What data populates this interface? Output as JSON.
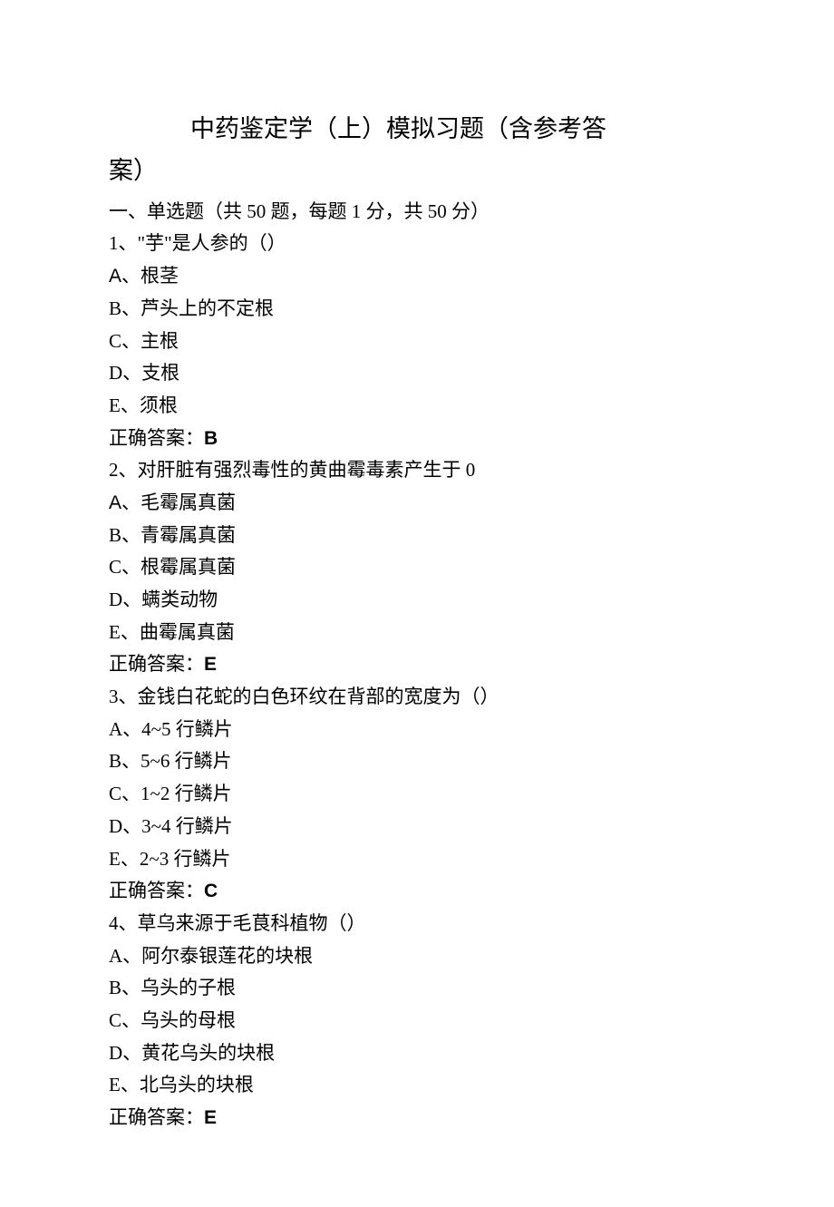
{
  "title_part1": "中药鉴定学（上）模拟习题（含参考答",
  "title_part2": "案）",
  "section_header": "一、单选题（共 50 题，每题 1 分，共 50 分）",
  "questions": [
    {
      "stem": "1、\"芋\"是人参的（）",
      "options": [
        "A、根茎",
        "B、芦头上的不定根",
        "C、主根",
        "D、支根",
        "E、须根"
      ],
      "answer_label": "正确答案：",
      "answer_value": "B",
      "opt_a_sans": true
    },
    {
      "stem": "2、对肝脏有强烈毒性的黄曲霉毒素产生于 0",
      "options": [
        "A、毛霉属真菌",
        "B、青霉属真菌",
        "C、根霉属真菌",
        "D、螨类动物",
        "E、曲霉属真菌"
      ],
      "answer_label": "正确答案：",
      "answer_value": "E",
      "opt_a_sans": true
    },
    {
      "stem": "3、金钱白花蛇的白色环纹在背部的宽度为（）",
      "options": [
        "A、4~5 行鳞片",
        "B、5~6 行鳞片",
        "C、1~2 行鳞片",
        "D、3~4 行鳞片",
        "E、2~3 行鳞片"
      ],
      "answer_label": "正确答案：",
      "answer_value": "C",
      "opt_a_sans": false
    },
    {
      "stem": "4、草乌来源于毛茛科植物（）",
      "options": [
        "A、阿尔泰银莲花的块根",
        "B、乌头的子根",
        "C、乌头的母根",
        "D、黄花乌头的块根",
        "E、北乌头的块根"
      ],
      "answer_label": "正确答案：",
      "answer_value": "E",
      "opt_a_sans": false
    }
  ]
}
